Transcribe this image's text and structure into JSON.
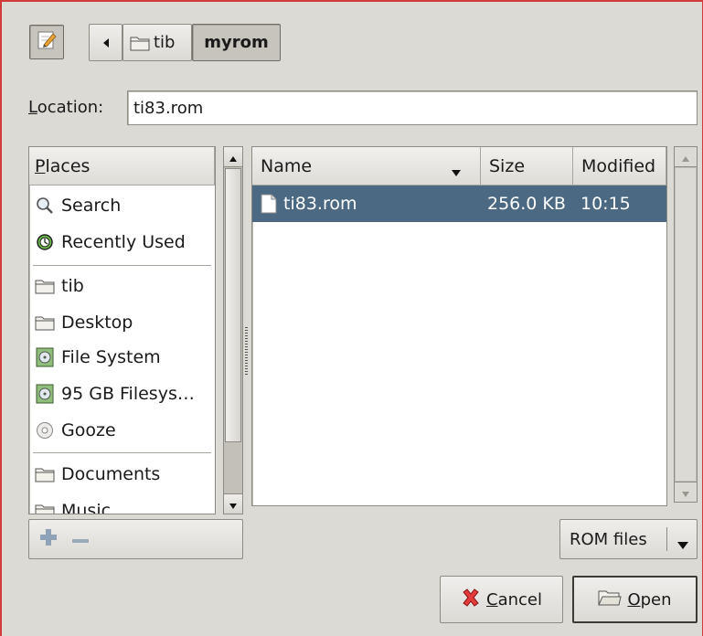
{
  "pathbar": {
    "segments": [
      {
        "label": "tib"
      },
      {
        "label": "myrom"
      }
    ]
  },
  "location": {
    "label_prefix": "L",
    "label_rest": "ocation:",
    "value": "ti83.rom"
  },
  "places": {
    "header_prefix": "P",
    "header_rest": "laces",
    "items": [
      {
        "label": "Search",
        "icon": "magnifier-icon"
      },
      {
        "label": "Recently Used",
        "icon": "recent-icon"
      },
      {
        "label": "tib",
        "icon": "folder-icon"
      },
      {
        "label": "Desktop",
        "icon": "folder-icon"
      },
      {
        "label": "File System",
        "icon": "drive-icon"
      },
      {
        "label": "95 GB Filesys…",
        "icon": "drive-icon"
      },
      {
        "label": "Gooze",
        "icon": "disc-icon"
      },
      {
        "label": "Documents",
        "icon": "folder-icon"
      },
      {
        "label": "Music",
        "icon": "folder-icon"
      }
    ]
  },
  "files": {
    "columns": {
      "name": "Name",
      "size": "Size",
      "modified": "Modified"
    },
    "rows": [
      {
        "name": "ti83.rom",
        "size": "256.0 KB",
        "modified": "10:15",
        "selected": true
      }
    ]
  },
  "filter": {
    "selected": "ROM files"
  },
  "actions": {
    "cancel_prefix": "C",
    "cancel_rest": "ancel",
    "open_prefix": "O",
    "open_rest": "pen"
  },
  "colors": {
    "selection": "#4b6983",
    "frame": "#d23b3b",
    "background": "#dcdad5"
  }
}
